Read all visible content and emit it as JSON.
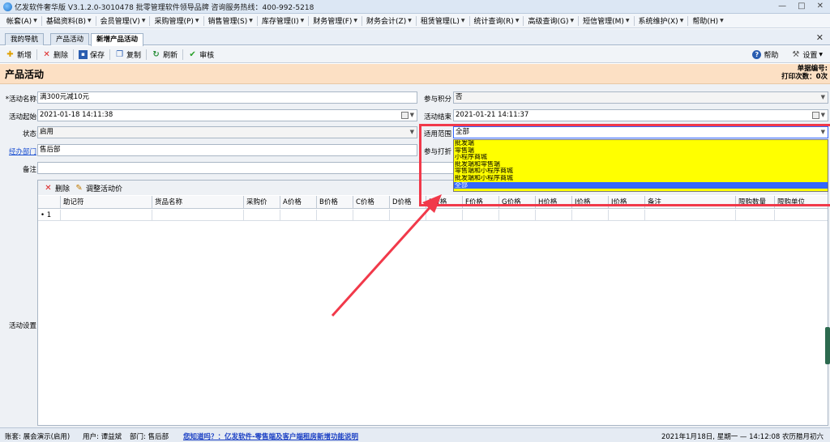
{
  "window": {
    "title": "亿发软件奢华版 V3.1.2.0-3010478 批零管理软件领导品牌 咨询服务热线：400-992-5218",
    "controls": [
      "—",
      "□",
      "✕"
    ]
  },
  "menubar": {
    "items": [
      "帐套(A)",
      "基础资料(B)",
      "会员管理(V)",
      "采购管理(P)",
      "销售管理(S)",
      "库存管理(I)",
      "财务管理(F)",
      "财务会计(Z)",
      "租赁管理(L)",
      "统计查询(R)",
      "高级查询(G)",
      "短信管理(M)",
      "系统维护(X)",
      "帮助(H)"
    ]
  },
  "tabs": {
    "items": [
      "我的导航",
      "产品活动",
      "新增产品活动"
    ],
    "close": "✕"
  },
  "toolbar": {
    "new_label": "新增",
    "delete_label": "删除",
    "save_label": "保存",
    "copy_label": "复制",
    "refresh_label": "刷新",
    "review_label": "审核",
    "help_label": "帮助",
    "settings_label": "设置"
  },
  "header": {
    "title": "产品活动",
    "doc_no_label": "单据编号:",
    "print_count": "打印次数：0次"
  },
  "form": {
    "activity_name_label": "*活动名称",
    "activity_name_value": "满300元减10元",
    "points_label": "参与积分",
    "points_value": "否",
    "start_label": "活动起始",
    "start_value": "2021-01-18 14:11:38",
    "end_label": "活动结束",
    "end_value": "2021-01-21 14:11:37",
    "status_label": "状态",
    "status_value": "启用",
    "scope_label": "适用范围",
    "scope_value": "全部",
    "dept_label": "经办部门",
    "dept_value": "售后部",
    "discount_label": "参与打折",
    "remark_label": "备注",
    "settings_label": "活动设置"
  },
  "scope_dropdown": {
    "options": [
      "批发端",
      "零售端",
      "小程序商城",
      "批发端和零售端",
      "零售端和小程序商城",
      "批发端和小程序商城",
      "全部"
    ],
    "selected": "全部"
  },
  "panel": {
    "delete_label": "删除",
    "adjust_label": "调整活动价",
    "columns": [
      "助记符",
      "货品名称",
      "采购价",
      "A价格",
      "B价格",
      "C价格",
      "D价格",
      "E价格",
      "F价格",
      "G价格",
      "H价格",
      "I价格",
      "J价格",
      "备注",
      "限购数量",
      "限购单位"
    ],
    "row_marker": "•",
    "row_number": "1"
  },
  "statusbar": {
    "account": "账套: 展会演示(启用)",
    "user": "用户: 谭益斌",
    "dept": "部门: 售后部",
    "promo": "您知道吗？：亿发软件-零售端及客户端租房新增功能说明",
    "datetime": "2021年1月18日, 星期一 — 14:12:08 农历腊月初六"
  },
  "colors": {
    "header_band": "#fce0c4",
    "dropdown_bg": "#ffff00",
    "dropdown_selected": "#3366ff",
    "highlight": "#f1394a"
  }
}
